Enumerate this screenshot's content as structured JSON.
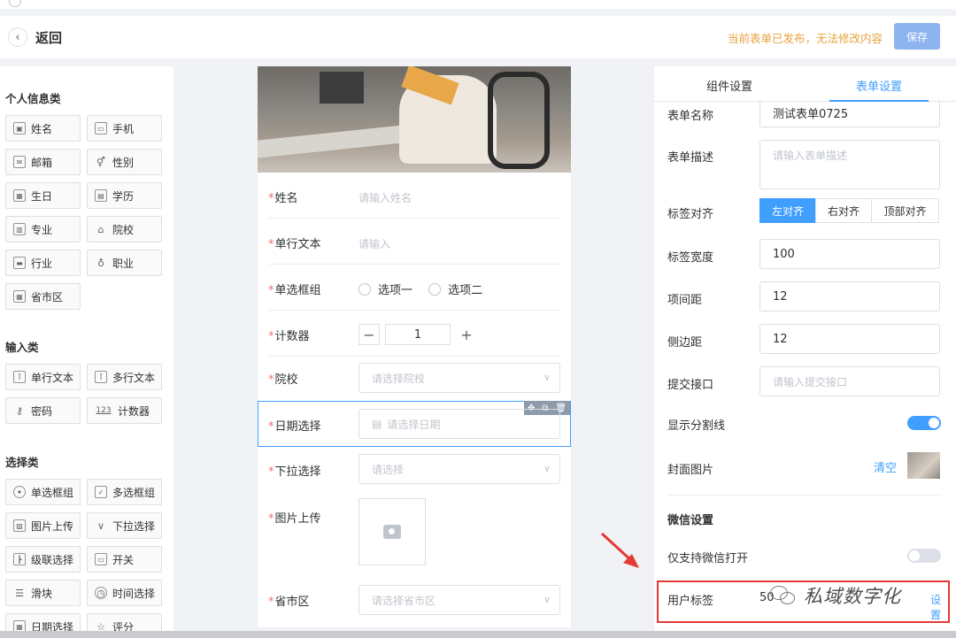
{
  "header": {
    "back_icon": "chevron-left-icon",
    "back_label": "返回",
    "notice": "当前表单已发布，无法修改内容",
    "save_label": "保存"
  },
  "palette": {
    "groups": [
      {
        "title": "个人信息类",
        "items": [
          {
            "label": "姓名",
            "icon": "user-card-icon"
          },
          {
            "label": "手机",
            "icon": "phone-icon"
          },
          {
            "label": "邮箱",
            "icon": "mail-icon"
          },
          {
            "label": "性别",
            "icon": "gender-icon"
          },
          {
            "label": "生日",
            "icon": "calendar-icon"
          },
          {
            "label": "学历",
            "icon": "certificate-icon"
          },
          {
            "label": "专业",
            "icon": "major-icon"
          },
          {
            "label": "院校",
            "icon": "school-icon"
          },
          {
            "label": "行业",
            "icon": "briefcase-icon"
          },
          {
            "label": "职业",
            "icon": "badge-icon"
          },
          {
            "label": "省市区",
            "icon": "building-icon"
          }
        ]
      },
      {
        "title": "输入类",
        "items": [
          {
            "label": "单行文本",
            "icon": "single-line-icon"
          },
          {
            "label": "多行文本",
            "icon": "multi-line-icon"
          },
          {
            "label": "密码",
            "icon": "key-icon"
          },
          {
            "label": "计数器",
            "icon": "counter-icon",
            "glyph": "123"
          }
        ]
      },
      {
        "title": "选择类",
        "items": [
          {
            "label": "单选框组",
            "icon": "radio-icon"
          },
          {
            "label": "多选框组",
            "icon": "checkbox-icon"
          },
          {
            "label": "图片上传",
            "icon": "image-icon"
          },
          {
            "label": "下拉选择",
            "icon": "chevron-down-icon"
          },
          {
            "label": "级联选择",
            "icon": "cascade-icon"
          },
          {
            "label": "开关",
            "icon": "switch-icon"
          },
          {
            "label": "滑块",
            "icon": "slider-icon"
          },
          {
            "label": "时间选择",
            "icon": "clock-icon"
          },
          {
            "label": "日期选择",
            "icon": "date-icon"
          },
          {
            "label": "评分",
            "icon": "star-icon"
          }
        ]
      }
    ]
  },
  "preview": {
    "fields": [
      {
        "label": "姓名",
        "placeholder": "请输入姓名"
      },
      {
        "label": "单行文本",
        "placeholder": "请输入"
      },
      {
        "label": "单选框组",
        "options": [
          "选项一",
          "选项二"
        ]
      },
      {
        "label": "计数器",
        "value": "1"
      },
      {
        "label": "院校",
        "placeholder": "请选择院校"
      },
      {
        "label": "日期选择",
        "placeholder": "请选择日期"
      },
      {
        "label": "下拉选择",
        "placeholder": "请选择"
      },
      {
        "label": "图片上传"
      },
      {
        "label": "省市区",
        "placeholder": "请选择省市区"
      }
    ],
    "required_mark": "*"
  },
  "settings": {
    "tabs": [
      "组件设置",
      "表单设置"
    ],
    "active_tab": 1,
    "form_name_label": "表单名称",
    "form_name_value": "测试表单0725",
    "form_desc_label": "表单描述",
    "form_desc_placeholder": "请输入表单描述",
    "label_align_label": "标签对齐",
    "label_align_options": [
      "左对齐",
      "右对齐",
      "顶部对齐"
    ],
    "label_align_active": 0,
    "label_width_label": "标签宽度",
    "label_width_value": "100",
    "item_gap_label": "项间距",
    "item_gap_value": "12",
    "side_gap_label": "侧边距",
    "side_gap_value": "12",
    "submit_api_label": "提交接口",
    "submit_api_placeholder": "请输入提交接口",
    "show_divider_label": "显示分割线",
    "show_divider_on": true,
    "cover_label": "封面图片",
    "cover_clear": "清空",
    "wechat_section": "微信设置",
    "wechat_only_label": "仅支持微信打开",
    "wechat_only_on": false,
    "user_tag_label": "用户标签",
    "user_tag_value_fragment": "50",
    "user_tag_link": "设置"
  },
  "watermark": {
    "text": "私域数字化",
    "icon": "wechat-logo-icon"
  },
  "colors": {
    "accent": "#409eff",
    "warning": "#e6a23c",
    "required": "#f56c6c",
    "highlight": "#e53935"
  }
}
